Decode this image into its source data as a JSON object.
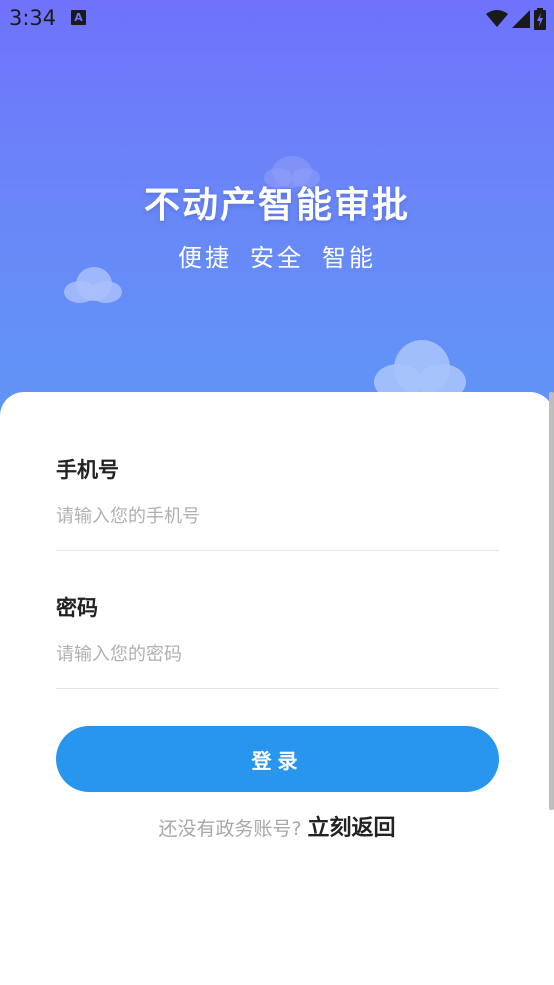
{
  "status_bar": {
    "time": "3:34",
    "icons": [
      "a-notification-icon",
      "wifi-icon",
      "signal-icon",
      "battery-icon"
    ]
  },
  "hero": {
    "title": "不动产智能审批",
    "subtitle": [
      "便捷",
      "安全",
      "智能"
    ]
  },
  "form": {
    "phone": {
      "label": "手机号",
      "placeholder": "请输入您的手机号",
      "value": ""
    },
    "password": {
      "label": "密码",
      "placeholder": "请输入您的密码",
      "value": ""
    },
    "login_label": "登录",
    "footer_prompt": "还没有政务账号?",
    "footer_link": "立刻返回"
  },
  "colors": {
    "hero_top": "#6f72fb",
    "hero_bottom": "#5f96f6",
    "button": "#2896ee",
    "placeholder": "#b0b0b0"
  }
}
